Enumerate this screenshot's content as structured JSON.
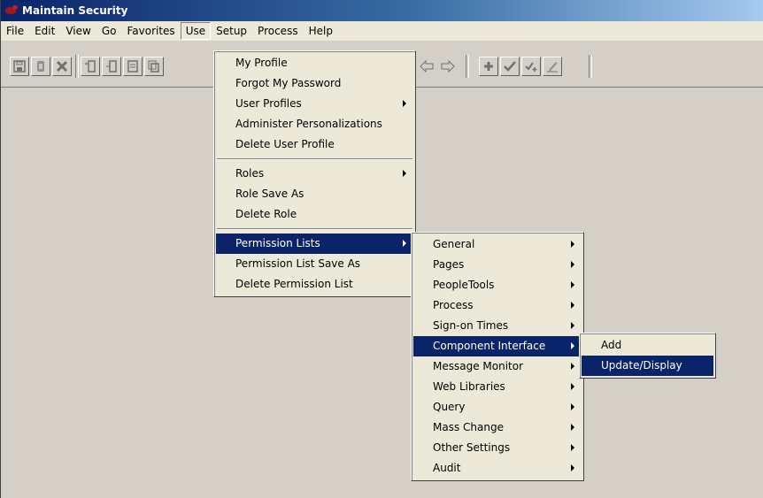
{
  "window": {
    "title": "Maintain Security"
  },
  "menubar": [
    "File",
    "Edit",
    "View",
    "Go",
    "Favorites",
    "Use",
    "Setup",
    "Process",
    "Help"
  ],
  "use_menu": {
    "group1": [
      {
        "label": "My Profile",
        "submenu": false
      },
      {
        "label": "Forgot My Password",
        "submenu": false
      },
      {
        "label": "User Profiles",
        "submenu": true
      },
      {
        "label": "Administer Personalizations",
        "submenu": false
      },
      {
        "label": "Delete User Profile",
        "submenu": false
      }
    ],
    "group2": [
      {
        "label": "Roles",
        "submenu": true
      },
      {
        "label": "Role Save As",
        "submenu": false
      },
      {
        "label": "Delete Role",
        "submenu": false
      }
    ],
    "group3": [
      {
        "label": "Permission Lists",
        "submenu": true,
        "highlighted": true
      },
      {
        "label": "Permission List Save As",
        "submenu": false
      },
      {
        "label": "Delete Permission List",
        "submenu": false
      }
    ]
  },
  "permission_lists_menu": [
    {
      "label": "General"
    },
    {
      "label": "Pages"
    },
    {
      "label": "PeopleTools"
    },
    {
      "label": "Process"
    },
    {
      "label": "Sign-on Times"
    },
    {
      "label": "Component Interface",
      "highlighted": true
    },
    {
      "label": "Message Monitor"
    },
    {
      "label": "Web Libraries"
    },
    {
      "label": "Query"
    },
    {
      "label": "Mass Change"
    },
    {
      "label": "Other Settings"
    },
    {
      "label": "Audit"
    }
  ],
  "component_interface_menu": [
    {
      "label": "Add"
    },
    {
      "label": "Update/Display",
      "highlighted": true
    }
  ],
  "toolbar_icons": [
    "save-icon",
    "phone-icon",
    "delete-icon",
    "insert-row-icon",
    "insert-row-icon",
    "list-icon",
    "copy-icon",
    "back-icon",
    "forward-icon",
    "add-icon",
    "check-icon",
    "check-plus-icon",
    "edit-icon"
  ]
}
